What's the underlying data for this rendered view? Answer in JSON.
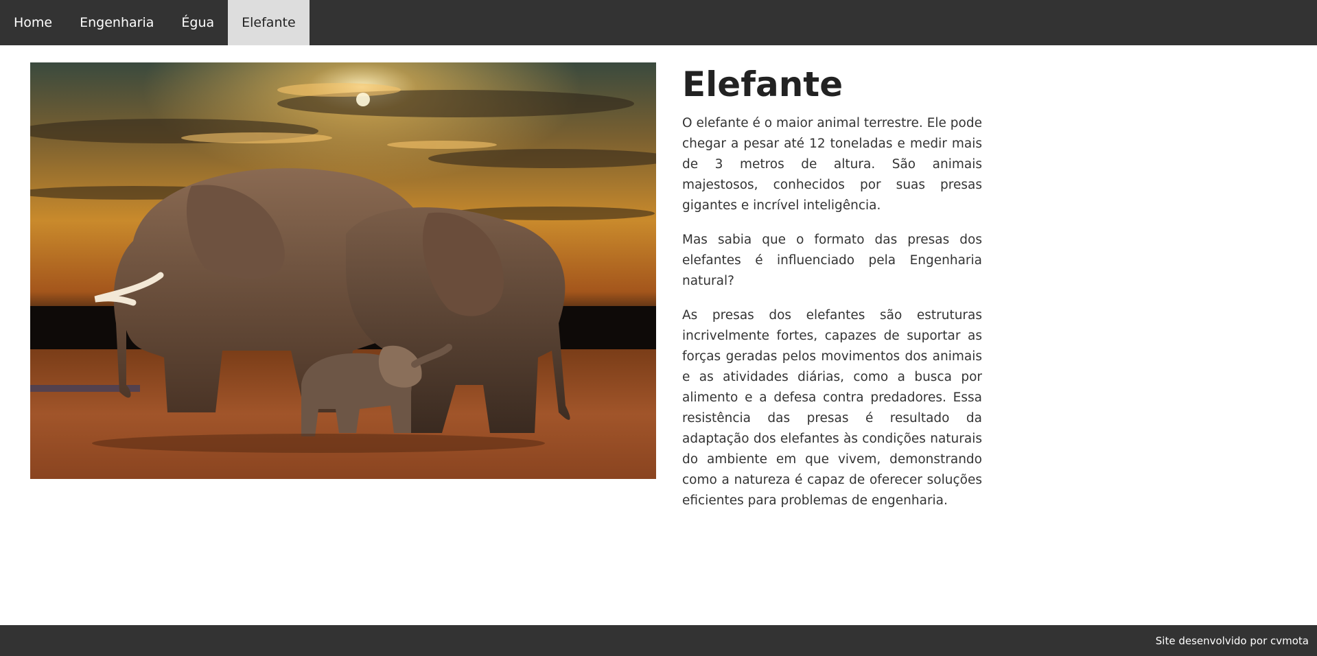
{
  "nav": {
    "items": [
      {
        "label": "Home",
        "active": false
      },
      {
        "label": "Engenharia",
        "active": false
      },
      {
        "label": "Égua",
        "active": false
      },
      {
        "label": "Elefante",
        "active": true
      }
    ]
  },
  "main": {
    "image_description": "elephant-family-sunset-photo",
    "title": "Elefante",
    "paragraphs": [
      "O elefante é o maior animal terrestre. Ele pode chegar a pesar até 12 toneladas e medir mais de 3 metros de altura. São animais majestosos, conhecidos por suas presas gigantes e incrível inteligência.",
      "Mas sabia que o formato das presas dos elefantes é influenciado pela Engenharia natural?",
      "As presas dos elefantes são estruturas incrivelmente fortes, capazes de suportar as forças geradas pelos movimentos dos animais e as atividades diárias, como a busca por alimento e a defesa contra predadores. Essa resistência das presas é resultado da adaptação dos elefantes às condições naturais do ambiente em que vivem, demonstrando como a natureza é capaz de oferecer soluções eficientes para problemas de engenharia."
    ]
  },
  "footer": {
    "text": "Site desenvolvido por cvmota"
  },
  "colors": {
    "nav_bg": "#333333",
    "nav_active_bg": "#dddddd",
    "footer_bg": "#333333"
  }
}
